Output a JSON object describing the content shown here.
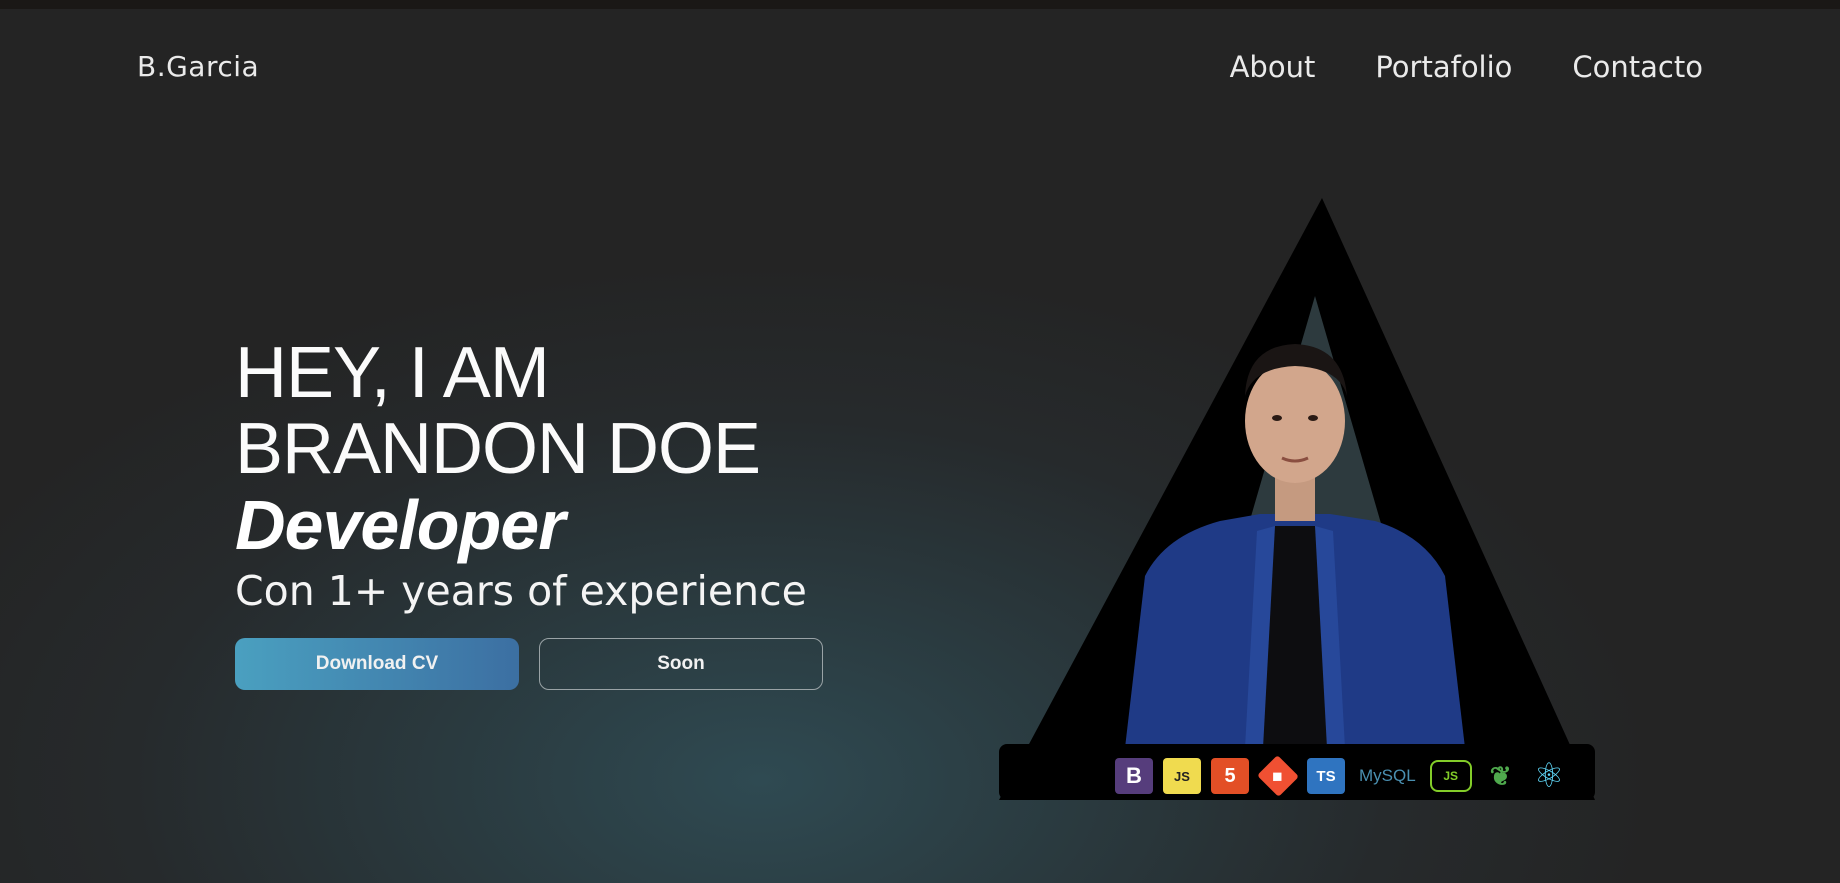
{
  "header": {
    "brand": "B.Garcia",
    "nav": [
      "About",
      "Portafolio",
      "Contacto"
    ]
  },
  "hero": {
    "line1": "HEY, I AM",
    "line2": "BRANDON DOE",
    "role": "Developer",
    "subtitle": "Con 1+ years of experience",
    "primary_button": "Download CV",
    "secondary_button": "Soon"
  },
  "tech_stack": [
    {
      "icon": "bootstrap-icon",
      "label": "B",
      "color": "#563d7c",
      "text": "#ffffff"
    },
    {
      "icon": "javascript-icon",
      "label": "JS",
      "color": "#f0db4f",
      "text": "#222222"
    },
    {
      "icon": "html5-icon",
      "label": "5",
      "color": "#e34f26",
      "text": "#ffffff"
    },
    {
      "icon": "git-icon",
      "label": "◆",
      "color": "#f05032",
      "text": "#ffffff"
    },
    {
      "icon": "typescript-icon",
      "label": "TS",
      "color": "#2f74c0",
      "text": "#ffffff"
    },
    {
      "icon": "mysql-icon",
      "label": "MySQL",
      "color": "transparent",
      "text": "#4a8fb0"
    },
    {
      "icon": "nodejs-icon",
      "label": "JS",
      "color": "transparent",
      "text": "#83cd29"
    },
    {
      "icon": "mongodb-icon",
      "label": "❦",
      "color": "transparent",
      "text": "#4fa94d"
    },
    {
      "icon": "react-icon",
      "label": "⚛",
      "color": "transparent",
      "text": "#61dafb"
    }
  ],
  "colors": {
    "accent_start": "#4aa0c0",
    "accent_end": "#3c6fa2",
    "background": "#242424"
  }
}
